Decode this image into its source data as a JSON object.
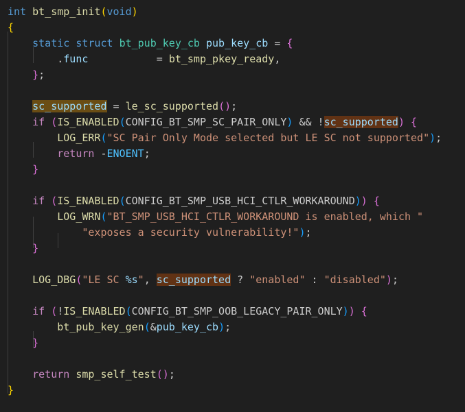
{
  "editor": {
    "colors": {
      "background": "#1f1f1f",
      "keyword": "#569cd6",
      "control": "#c586c0",
      "function": "#dcdcaa",
      "type": "#4ec9b0",
      "variable": "#9cdcfe",
      "macro": "#4fc1ff",
      "string": "#ce9178",
      "bracket_1": "#ffd700",
      "bracket_2": "#da70d6",
      "bracket_3": "#179fff",
      "highlight_read": "#613214",
      "highlight_write": "#6a4d14"
    },
    "lines": [
      {
        "tokens": [
          {
            "t": "int",
            "c": "kw"
          },
          {
            "t": " ",
            "c": "p"
          },
          {
            "t": "bt_smp_init",
            "c": "fn"
          },
          {
            "t": "(",
            "c": "br1"
          },
          {
            "t": "void",
            "c": "kw"
          },
          {
            "t": ")",
            "c": "br1"
          }
        ]
      },
      {
        "tokens": [
          {
            "t": "{",
            "c": "br1"
          }
        ]
      },
      {
        "tokens": [
          {
            "t": "    ",
            "c": "p"
          },
          {
            "t": "static",
            "c": "kw"
          },
          {
            "t": " ",
            "c": "p"
          },
          {
            "t": "struct",
            "c": "kw"
          },
          {
            "t": " ",
            "c": "p"
          },
          {
            "t": "bt_pub_key_cb",
            "c": "type"
          },
          {
            "t": " ",
            "c": "p"
          },
          {
            "t": "pub_key_cb",
            "c": "var"
          },
          {
            "t": " = ",
            "c": "p"
          },
          {
            "t": "{",
            "c": "br2"
          }
        ]
      },
      {
        "tokens": [
          {
            "t": "        ",
            "c": "p"
          },
          {
            "t": ".",
            "c": "p"
          },
          {
            "t": "func",
            "c": "var"
          },
          {
            "t": "           = ",
            "c": "p"
          },
          {
            "t": "bt_smp_pkey_ready",
            "c": "fn"
          },
          {
            "t": ",",
            "c": "p"
          }
        ]
      },
      {
        "tokens": [
          {
            "t": "    ",
            "c": "p"
          },
          {
            "t": "}",
            "c": "br2"
          },
          {
            "t": ";",
            "c": "p"
          }
        ]
      },
      {
        "tokens": []
      },
      {
        "tokens": [
          {
            "t": "    ",
            "c": "p"
          },
          {
            "t": "sc_supported",
            "c": "var",
            "hl": "b"
          },
          {
            "t": " = ",
            "c": "p"
          },
          {
            "t": "le_sc_supported",
            "c": "fn"
          },
          {
            "t": "(",
            "c": "br2"
          },
          {
            "t": ")",
            "c": "br2"
          },
          {
            "t": ";",
            "c": "p"
          }
        ]
      },
      {
        "tokens": [
          {
            "t": "    ",
            "c": "p"
          },
          {
            "t": "if",
            "c": "ctl"
          },
          {
            "t": " ",
            "c": "p"
          },
          {
            "t": "(",
            "c": "br2"
          },
          {
            "t": "IS_ENABLED",
            "c": "fn"
          },
          {
            "t": "(",
            "c": "br3"
          },
          {
            "t": "CONFIG_BT_SMP_SC_PAIR_ONLY",
            "c": "p"
          },
          {
            "t": ")",
            "c": "br3"
          },
          {
            "t": " && !",
            "c": "p"
          },
          {
            "t": "sc_supported",
            "c": "var",
            "hl": "a"
          },
          {
            "t": ")",
            "c": "br2"
          },
          {
            "t": " ",
            "c": "p"
          },
          {
            "t": "{",
            "c": "br2"
          }
        ]
      },
      {
        "tokens": [
          {
            "t": "        ",
            "c": "p"
          },
          {
            "t": "LOG_ERR",
            "c": "fn"
          },
          {
            "t": "(",
            "c": "br3"
          },
          {
            "t": "\"SC Pair Only Mode selected but LE SC not supported\"",
            "c": "str"
          },
          {
            "t": ")",
            "c": "br3"
          },
          {
            "t": ";",
            "c": "p"
          }
        ]
      },
      {
        "tokens": [
          {
            "t": "        ",
            "c": "p"
          },
          {
            "t": "return",
            "c": "ctl"
          },
          {
            "t": " -",
            "c": "p"
          },
          {
            "t": "ENOENT",
            "c": "const"
          },
          {
            "t": ";",
            "c": "p"
          }
        ]
      },
      {
        "tokens": [
          {
            "t": "    ",
            "c": "p"
          },
          {
            "t": "}",
            "c": "br2"
          }
        ]
      },
      {
        "tokens": []
      },
      {
        "tokens": [
          {
            "t": "    ",
            "c": "p"
          },
          {
            "t": "if",
            "c": "ctl"
          },
          {
            "t": " ",
            "c": "p"
          },
          {
            "t": "(",
            "c": "br2"
          },
          {
            "t": "IS_ENABLED",
            "c": "fn"
          },
          {
            "t": "(",
            "c": "br3"
          },
          {
            "t": "CONFIG_BT_SMP_USB_HCI_CTLR_WORKAROUND",
            "c": "p"
          },
          {
            "t": ")",
            "c": "br3"
          },
          {
            "t": ")",
            "c": "br2"
          },
          {
            "t": " ",
            "c": "p"
          },
          {
            "t": "{",
            "c": "br2"
          }
        ]
      },
      {
        "tokens": [
          {
            "t": "        ",
            "c": "p"
          },
          {
            "t": "LOG_WRN",
            "c": "fn"
          },
          {
            "t": "(",
            "c": "br3"
          },
          {
            "t": "\"BT_SMP_USB_HCI_CTLR_WORKAROUND is enabled, which \"",
            "c": "str"
          }
        ]
      },
      {
        "tokens": [
          {
            "t": "            ",
            "c": "p"
          },
          {
            "t": "\"exposes a security vulnerability!\"",
            "c": "str"
          },
          {
            "t": ")",
            "c": "br3"
          },
          {
            "t": ";",
            "c": "p"
          }
        ]
      },
      {
        "tokens": [
          {
            "t": "    ",
            "c": "p"
          },
          {
            "t": "}",
            "c": "br2"
          }
        ]
      },
      {
        "tokens": []
      },
      {
        "tokens": [
          {
            "t": "    ",
            "c": "p"
          },
          {
            "t": "LOG_DBG",
            "c": "fn"
          },
          {
            "t": "(",
            "c": "br2"
          },
          {
            "t": "\"LE SC ",
            "c": "str"
          },
          {
            "t": "%s",
            "c": "fmt"
          },
          {
            "t": "\"",
            "c": "str"
          },
          {
            "t": ", ",
            "c": "p"
          },
          {
            "t": "sc_supported",
            "c": "var",
            "hl": "a"
          },
          {
            "t": " ? ",
            "c": "p"
          },
          {
            "t": "\"enabled\"",
            "c": "str"
          },
          {
            "t": " : ",
            "c": "p"
          },
          {
            "t": "\"disabled\"",
            "c": "str"
          },
          {
            "t": ")",
            "c": "br2"
          },
          {
            "t": ";",
            "c": "p"
          }
        ]
      },
      {
        "tokens": []
      },
      {
        "tokens": [
          {
            "t": "    ",
            "c": "p"
          },
          {
            "t": "if",
            "c": "ctl"
          },
          {
            "t": " ",
            "c": "p"
          },
          {
            "t": "(",
            "c": "br2"
          },
          {
            "t": "!",
            "c": "p"
          },
          {
            "t": "IS_ENABLED",
            "c": "fn"
          },
          {
            "t": "(",
            "c": "br3"
          },
          {
            "t": "CONFIG_BT_SMP_OOB_LEGACY_PAIR_ONLY",
            "c": "p"
          },
          {
            "t": ")",
            "c": "br3"
          },
          {
            "t": ")",
            "c": "br2"
          },
          {
            "t": " ",
            "c": "p"
          },
          {
            "t": "{",
            "c": "br2"
          }
        ]
      },
      {
        "tokens": [
          {
            "t": "        ",
            "c": "p"
          },
          {
            "t": "bt_pub_key_gen",
            "c": "fn"
          },
          {
            "t": "(",
            "c": "br3"
          },
          {
            "t": "&",
            "c": "p"
          },
          {
            "t": "pub_key_cb",
            "c": "var"
          },
          {
            "t": ")",
            "c": "br3"
          },
          {
            "t": ";",
            "c": "p"
          }
        ]
      },
      {
        "tokens": [
          {
            "t": "    ",
            "c": "p"
          },
          {
            "t": "}",
            "c": "br2"
          }
        ]
      },
      {
        "tokens": []
      },
      {
        "tokens": [
          {
            "t": "    ",
            "c": "p"
          },
          {
            "t": "return",
            "c": "ctl"
          },
          {
            "t": " ",
            "c": "p"
          },
          {
            "t": "smp_self_test",
            "c": "fn"
          },
          {
            "t": "(",
            "c": "br2"
          },
          {
            "t": ")",
            "c": "br2"
          },
          {
            "t": ";",
            "c": "p"
          }
        ]
      },
      {
        "tokens": [
          {
            "t": "}",
            "c": "br1"
          }
        ]
      }
    ]
  }
}
